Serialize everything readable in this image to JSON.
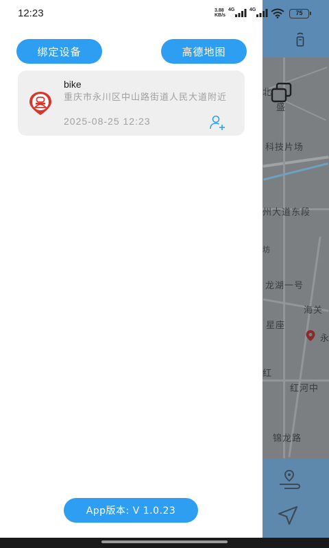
{
  "status_bar": {
    "time": "12:23",
    "net_speed_value": "3.88",
    "net_speed_unit": "KB/s",
    "signal1_label": "4G",
    "signal2_label": "4G",
    "battery": "75"
  },
  "toolbar": {
    "bind_device_label": "绑定设备",
    "amap_label": "高德地图"
  },
  "device": {
    "name": "bike",
    "address": "重庆市永川区中山路街道人民大道附近",
    "time": "2025-08-25 12:23"
  },
  "footer": {
    "version_label": "App版本: V 1.0.23"
  },
  "map": {
    "labels": [
      "科技片场",
      "州大道东段",
      "龙湖一号",
      "海关",
      "星座",
      "永",
      "红河中",
      "锦龙路",
      "北",
      "盛",
      "红",
      "坊"
    ]
  },
  "colors": {
    "accent": "#2e9ef2",
    "device_icon": "#d9362b",
    "card_bg": "#efefef"
  },
  "icons": {
    "device": "person-badge-icon",
    "share": "add-user-icon",
    "layers": "layers-icon",
    "tracker": "tracker-icon",
    "route": "route-icon",
    "locate": "navigation-arrow-icon"
  }
}
